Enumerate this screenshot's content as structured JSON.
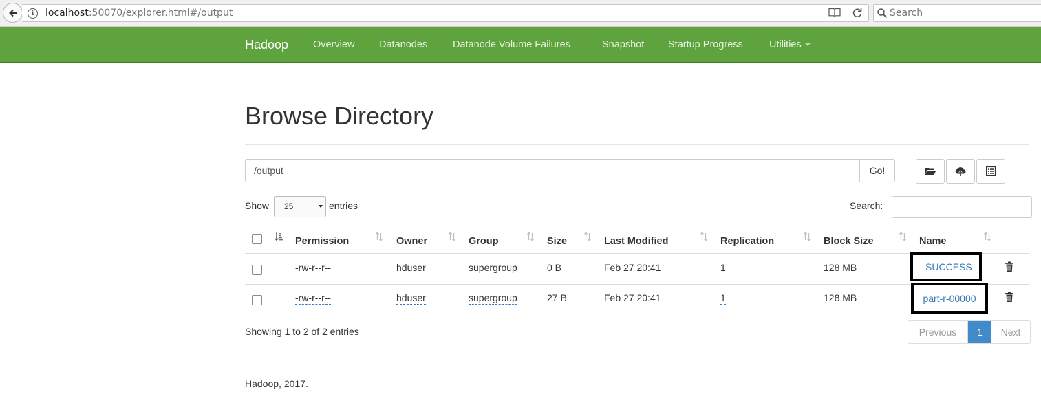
{
  "browser": {
    "url_host": "localhost",
    "url_rest": ":50070/explorer.html#/output",
    "search_placeholder": "Search"
  },
  "navbar": {
    "brand": "Hadoop",
    "color": "#5fa33e",
    "items": [
      "Overview",
      "Datanodes",
      "Datanode Volume Failures",
      "Snapshot",
      "Startup Progress",
      "Utilities"
    ]
  },
  "page": {
    "title": "Browse Directory",
    "path_value": "/output",
    "go_label": "Go!",
    "toolbar_icons": [
      "folder-open-icon",
      "cloud-upload-icon",
      "list-alt-icon"
    ]
  },
  "table_controls": {
    "show_label": "Show",
    "page_size": "25",
    "entries_label": "entries",
    "search_label": "Search:"
  },
  "table": {
    "columns": [
      "Permission",
      "Owner",
      "Group",
      "Size",
      "Last Modified",
      "Replication",
      "Block Size",
      "Name"
    ],
    "rows": [
      {
        "permission": "-rw-r--r--",
        "owner": "hduser",
        "group": "supergroup",
        "size": "0 B",
        "last_modified": "Feb 27 20:41",
        "replication": "1",
        "block_size": "128 MB",
        "name": "_SUCCESS"
      },
      {
        "permission": "-rw-r--r--",
        "owner": "hduser",
        "group": "supergroup",
        "size": "27 B",
        "last_modified": "Feb 27 20:41",
        "replication": "1",
        "block_size": "128 MB",
        "name": "part-r-00000"
      }
    ]
  },
  "footer_info": {
    "showing": "Showing 1 to 2 of 2 entries",
    "pagination": {
      "previous": "Previous",
      "current": "1",
      "next": "Next"
    }
  },
  "footer": {
    "text": "Hadoop, 2017."
  }
}
